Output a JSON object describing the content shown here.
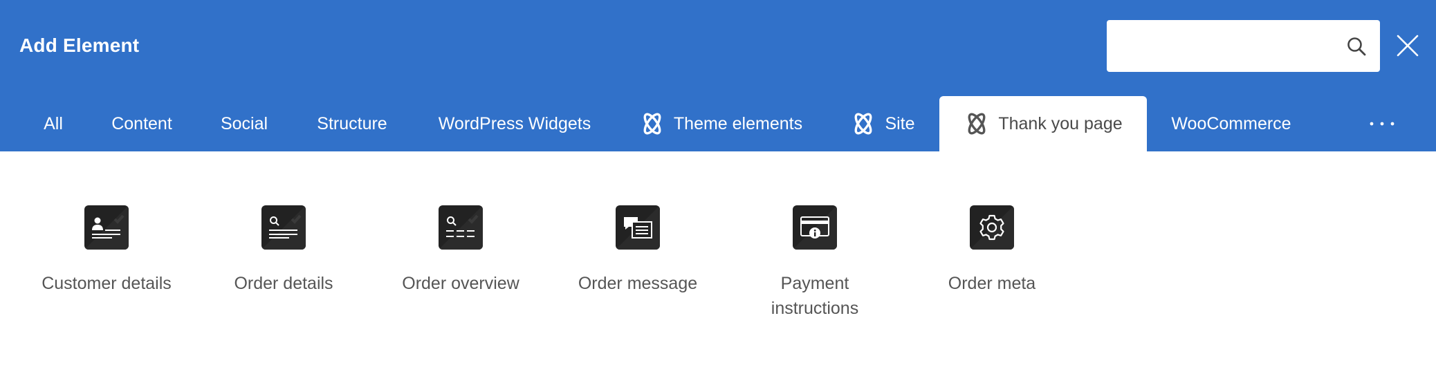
{
  "dialog": {
    "title": "Add Element",
    "search": {
      "value": "",
      "placeholder": ""
    }
  },
  "tabs": [
    {
      "label": "All",
      "icon": "",
      "active": false
    },
    {
      "label": "Content",
      "icon": "",
      "active": false
    },
    {
      "label": "Social",
      "icon": "",
      "active": false
    },
    {
      "label": "Structure",
      "icon": "",
      "active": false
    },
    {
      "label": "WordPress Widgets",
      "icon": "",
      "active": false
    },
    {
      "label": "Theme elements",
      "icon": "jetpack-x-logo-icon",
      "active": false
    },
    {
      "label": "Site",
      "icon": "jetpack-x-logo-icon",
      "active": false
    },
    {
      "label": "Thank you page",
      "icon": "jetpack-x-logo-icon",
      "active": true
    },
    {
      "label": "WooCommerce",
      "icon": "",
      "active": false
    }
  ],
  "more_tabs_glyph": "···",
  "elements": [
    {
      "label": "Customer details",
      "icon": "customer-card-icon"
    },
    {
      "label": "Order details",
      "icon": "order-search-icon"
    },
    {
      "label": "Order overview",
      "icon": "order-overview-icon"
    },
    {
      "label": "Order message",
      "icon": "message-icon"
    },
    {
      "label": "Payment instructions",
      "icon": "payment-card-icon"
    },
    {
      "label": "Order meta",
      "icon": "gear-icon"
    }
  ],
  "colors": {
    "header": "#3171c9",
    "tab_text": "#ffffff",
    "active_tab_text": "#4a4a4a",
    "icon_tile": "#222222",
    "element_label": "#555555"
  }
}
